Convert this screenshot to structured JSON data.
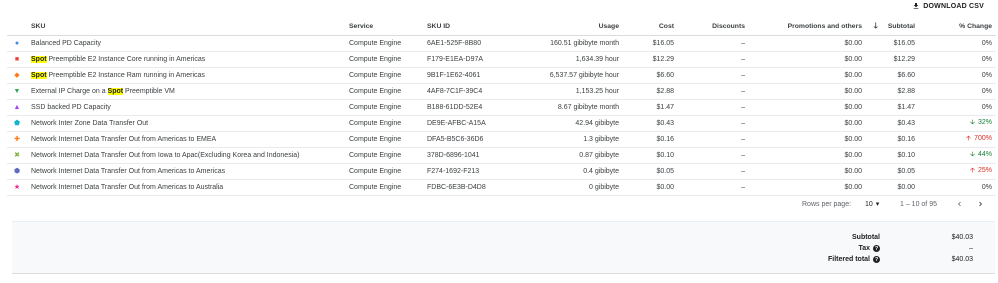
{
  "toolbar": {
    "download_label": "DOWNLOAD CSV",
    "download_icon": "download-icon"
  },
  "columns": {
    "sku": "SKU",
    "service": "Service",
    "sku_id": "SKU ID",
    "usage": "Usage",
    "cost": "Cost",
    "discounts": "Discounts",
    "promotions": "Promotions and others",
    "subtotal": "Subtotal",
    "change": "% Change"
  },
  "rows": [
    {
      "marker": "●",
      "marker_color": "#4285f4",
      "pre": "Balanced PD Capacity",
      "hl": "",
      "post": "",
      "service": "Compute Engine",
      "sku_id": "6AE1-525F-8B80",
      "usage": "160.51 gibibyte month",
      "cost": "$16.05",
      "discounts": "–",
      "promotions": "$0.00",
      "subtotal": "$16.05",
      "change": "0%",
      "change_dir": ""
    },
    {
      "marker": "■",
      "marker_color": "#ea4335",
      "pre": "",
      "hl": "Spot",
      "post": " Preemptible E2 Instance Core running in Americas",
      "service": "Compute Engine",
      "sku_id": "F179-E1EA-D97A",
      "usage": "1,634.39 hour",
      "cost": "$12.29",
      "discounts": "–",
      "promotions": "$0.00",
      "subtotal": "$12.29",
      "change": "0%",
      "change_dir": ""
    },
    {
      "marker": "◆",
      "marker_color": "#fa7b17",
      "pre": "",
      "hl": "Spot",
      "post": " Preemptible E2 Instance Ram running in Americas",
      "service": "Compute Engine",
      "sku_id": "9B1F-1E62-4061",
      "usage": "6,537.57 gibibyte hour",
      "cost": "$6.60",
      "discounts": "–",
      "promotions": "$0.00",
      "subtotal": "$6.60",
      "change": "0%",
      "change_dir": ""
    },
    {
      "marker": "▼",
      "marker_color": "#34a853",
      "pre": "External IP Charge on a ",
      "hl": "Spot",
      "post": " Preemptible VM",
      "service": "Compute Engine",
      "sku_id": "4AF8-7C1F-39C4",
      "usage": "1,153.25 hour",
      "cost": "$2.88",
      "discounts": "–",
      "promotions": "$0.00",
      "subtotal": "$2.88",
      "change": "0%",
      "change_dir": ""
    },
    {
      "marker": "▲",
      "marker_color": "#a142f4",
      "pre": "SSD backed PD Capacity",
      "hl": "",
      "post": "",
      "service": "Compute Engine",
      "sku_id": "B188-61DD-52E4",
      "usage": "8.67 gibibyte month",
      "cost": "$1.47",
      "discounts": "–",
      "promotions": "$0.00",
      "subtotal": "$1.47",
      "change": "0%",
      "change_dir": ""
    },
    {
      "marker": "⬟",
      "marker_color": "#12b5cb",
      "pre": "Network Inter Zone Data Transfer Out",
      "hl": "",
      "post": "",
      "service": "Compute Engine",
      "sku_id": "DE9E-AFBC-A15A",
      "usage": "42.94 gibibyte",
      "cost": "$0.43",
      "discounts": "–",
      "promotions": "$0.00",
      "subtotal": "$0.43",
      "change": "32%",
      "change_dir": "down"
    },
    {
      "marker": "✚",
      "marker_color": "#fa7b17",
      "pre": "Network Internet Data Transfer Out from Americas to EMEA",
      "hl": "",
      "post": "",
      "service": "Compute Engine",
      "sku_id": "DFA5-B5C6-36D6",
      "usage": "1.3 gibibyte",
      "cost": "$0.16",
      "discounts": "–",
      "promotions": "$0.00",
      "subtotal": "$0.16",
      "change": "700%",
      "change_dir": "up"
    },
    {
      "marker": "✖",
      "marker_color": "#7cb342",
      "pre": "Network Internet Data Transfer Out from Iowa to Apac(Excluding Korea and Indonesia)",
      "hl": "",
      "post": "",
      "service": "Compute Engine",
      "sku_id": "378D-6896-1041",
      "usage": "0.87 gibibyte",
      "cost": "$0.10",
      "discounts": "–",
      "promotions": "$0.00",
      "subtotal": "$0.10",
      "change": "44%",
      "change_dir": "down"
    },
    {
      "marker": "⬢",
      "marker_color": "#5c6bc0",
      "pre": "Network Internet Data Transfer Out from Americas to Americas",
      "hl": "",
      "post": "",
      "service": "Compute Engine",
      "sku_id": "F274-1692-F213",
      "usage": "0.4 gibibyte",
      "cost": "$0.05",
      "discounts": "–",
      "promotions": "$0.00",
      "subtotal": "$0.05",
      "change": "25%",
      "change_dir": "up"
    },
    {
      "marker": "★",
      "marker_color": "#e52592",
      "pre": "Network Internet Data Transfer Out from Americas to Australia",
      "hl": "",
      "post": "",
      "service": "Compute Engine",
      "sku_id": "FDBC-6E3B-D4D8",
      "usage": "0 gibibyte",
      "cost": "$0.00",
      "discounts": "–",
      "promotions": "$0.00",
      "subtotal": "$0.00",
      "change": "0%",
      "change_dir": ""
    }
  ],
  "pagination": {
    "rows_per_page_label": "Rows per page:",
    "rows_per_page_value": "10",
    "range_label": "1 – 10 of 95"
  },
  "summary": {
    "subtotal_label": "Subtotal",
    "subtotal_value": "$40.03",
    "tax_label": "Tax",
    "tax_value": "–",
    "filtered_total_label": "Filtered total",
    "filtered_total_value": "$40.03"
  },
  "colors": {
    "down": "#188038",
    "up": "#d93025",
    "highlight": "#ffff00"
  }
}
